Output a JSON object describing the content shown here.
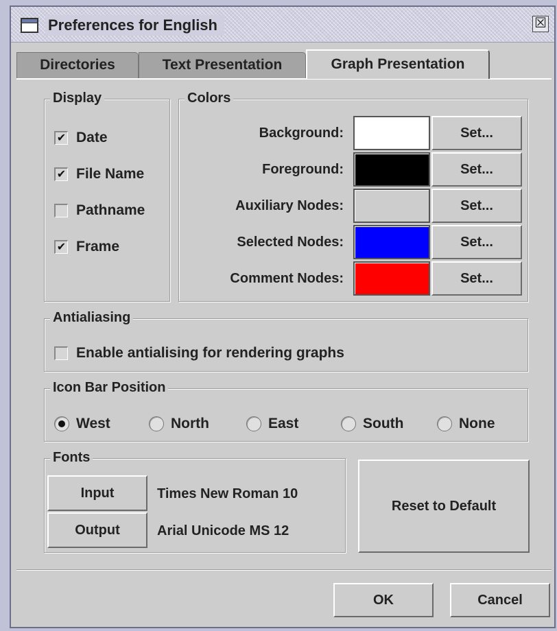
{
  "window": {
    "title": "Preferences for English",
    "close_glyph": "☒"
  },
  "tabs": [
    {
      "label": "Directories",
      "active": false
    },
    {
      "label": "Text Presentation",
      "active": false
    },
    {
      "label": "Graph Presentation",
      "active": true
    }
  ],
  "display": {
    "title": "Display",
    "items": [
      {
        "label": "Date",
        "checked": true
      },
      {
        "label": "File Name",
        "checked": true
      },
      {
        "label": "Pathname",
        "checked": false
      },
      {
        "label": "Frame",
        "checked": true
      }
    ]
  },
  "colors": {
    "title": "Colors",
    "set_label": "Set...",
    "items": [
      {
        "label": "Background:",
        "color": "#ffffff"
      },
      {
        "label": "Foreground:",
        "color": "#000000"
      },
      {
        "label": "Auxiliary Nodes:",
        "color": "#cdcdcd"
      },
      {
        "label": "Selected Nodes:",
        "color": "#0000ff"
      },
      {
        "label": "Comment Nodes:",
        "color": "#ff0000"
      }
    ]
  },
  "antialiasing": {
    "title": "Antialiasing",
    "option_label": "Enable antialising for rendering graphs",
    "checked": false
  },
  "icon_bar": {
    "title": "Icon Bar Position",
    "options": [
      {
        "label": "West",
        "selected": true
      },
      {
        "label": "North",
        "selected": false
      },
      {
        "label": "East",
        "selected": false
      },
      {
        "label": "South",
        "selected": false
      },
      {
        "label": "None",
        "selected": false
      }
    ]
  },
  "fonts": {
    "title": "Fonts",
    "input_label": "Input",
    "input_font": "Times New Roman  10",
    "output_label": "Output",
    "output_font": "Arial Unicode MS  12"
  },
  "reset_label": "Reset to Default",
  "footer": {
    "ok_label": "OK",
    "cancel_label": "Cancel"
  },
  "check_glyph": "✔"
}
